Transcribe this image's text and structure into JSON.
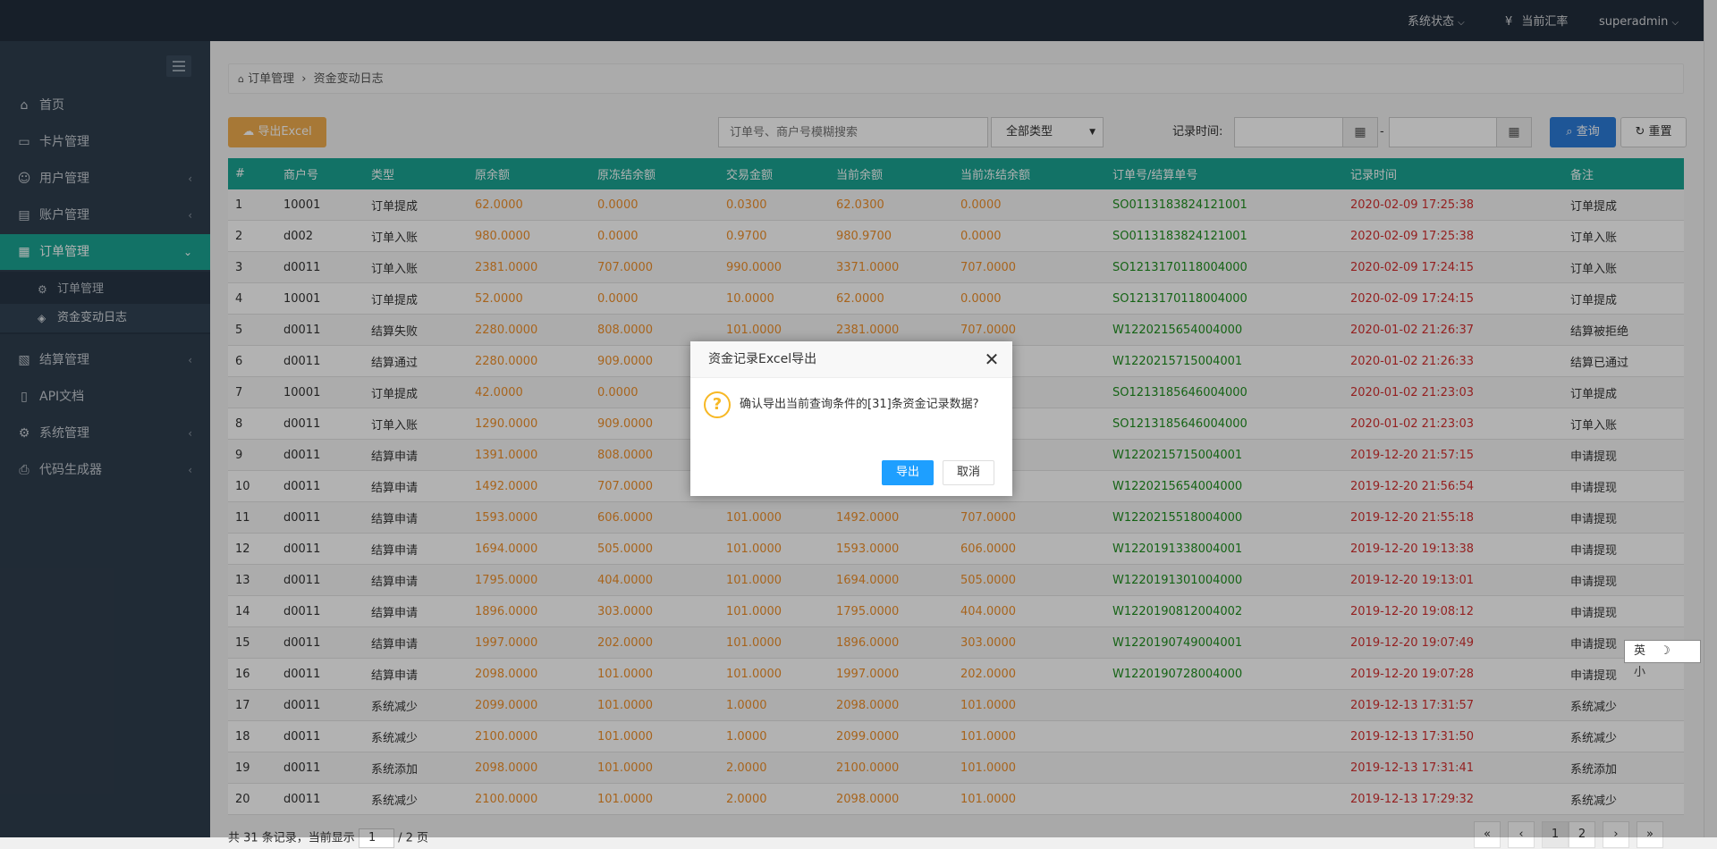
{
  "topbar": {
    "system_status": "系统状态",
    "currency_symbol": "¥",
    "exchange_rate": "当前汇率",
    "user": "superadmin"
  },
  "sidebar": {
    "items": [
      {
        "label": "首页",
        "icon": "home-icon",
        "glyph": "⌂"
      },
      {
        "label": "卡片管理",
        "icon": "card-icon",
        "glyph": "▭"
      },
      {
        "label": "用户管理",
        "icon": "user-icon",
        "glyph": "☺"
      },
      {
        "label": "账户管理",
        "icon": "account-icon",
        "glyph": "▤"
      },
      {
        "label": "订单管理",
        "icon": "order-icon",
        "glyph": "▦"
      },
      {
        "label": "结算管理",
        "icon": "settlement-icon",
        "glyph": "▧"
      },
      {
        "label": "API文档",
        "icon": "doc-icon",
        "glyph": "▯"
      },
      {
        "label": "系统管理",
        "icon": "gear-icon",
        "glyph": "⚙"
      },
      {
        "label": "代码生成器",
        "icon": "printer-icon",
        "glyph": "⎙"
      }
    ],
    "submenu": [
      {
        "label": "订单管理",
        "glyph": "⚙"
      },
      {
        "label": "资金变动日志",
        "glyph": "◈"
      }
    ]
  },
  "breadcrumb": {
    "root": "订单管理",
    "separator": "›",
    "current": "资金变动日志"
  },
  "toolbar": {
    "export_label": "导出Excel",
    "search_placeholder": "订单号、商户号模糊搜索",
    "type_select": "全部类型",
    "time_label": "记录时间:",
    "dash": "-",
    "query_label": "查询",
    "reset_label": "重置"
  },
  "table": {
    "headers": [
      "#",
      "商户号",
      "类型",
      "原余额",
      "原冻结余额",
      "交易金额",
      "当前余额",
      "当前冻结余额",
      "订单号/结算单号",
      "记录时间",
      "备注"
    ],
    "rows": [
      [
        "1",
        "10001",
        "订单提成",
        "62.0000",
        "0.0000",
        "0.0300",
        "62.0300",
        "0.0000",
        "SO0113183824121001",
        "2020-02-09 17:25:38",
        "订单提成"
      ],
      [
        "2",
        "d002",
        "订单入账",
        "980.0000",
        "0.0000",
        "0.9700",
        "980.9700",
        "0.0000",
        "SO0113183824121001",
        "2020-02-09 17:25:38",
        "订单入账"
      ],
      [
        "3",
        "d0011",
        "订单入账",
        "2381.0000",
        "707.0000",
        "990.0000",
        "3371.0000",
        "707.0000",
        "SO1213170118004000",
        "2020-02-09 17:24:15",
        "订单入账"
      ],
      [
        "4",
        "10001",
        "订单提成",
        "52.0000",
        "0.0000",
        "10.0000",
        "62.0000",
        "0.0000",
        "SO1213170118004000",
        "2020-02-09 17:24:15",
        "订单提成"
      ],
      [
        "5",
        "d0011",
        "结算失败",
        "2280.0000",
        "808.0000",
        "101.0000",
        "2381.0000",
        "707.0000",
        "W1220215654004000",
        "2020-01-02 21:26:37",
        "结算被拒绝"
      ],
      [
        "6",
        "d0011",
        "结算通过",
        "2280.0000",
        "909.0000",
        "",
        "",
        "",
        "W1220215715004001",
        "2020-01-02 21:26:33",
        "结算已通过"
      ],
      [
        "7",
        "10001",
        "订单提成",
        "42.0000",
        "0.0000",
        "",
        "",
        "",
        "SO1213185646004000",
        "2020-01-02 21:23:03",
        "订单提成"
      ],
      [
        "8",
        "d0011",
        "订单入账",
        "1290.0000",
        "909.0000",
        "",
        "",
        "",
        "SO1213185646004000",
        "2020-01-02 21:23:03",
        "订单入账"
      ],
      [
        "9",
        "d0011",
        "结算申请",
        "1391.0000",
        "808.0000",
        "",
        "",
        "",
        "W1220215715004001",
        "2019-12-20 21:57:15",
        "申请提现"
      ],
      [
        "10",
        "d0011",
        "结算申请",
        "1492.0000",
        "707.0000",
        "",
        "",
        "",
        "W1220215654004000",
        "2019-12-20 21:56:54",
        "申请提现"
      ],
      [
        "11",
        "d0011",
        "结算申请",
        "1593.0000",
        "606.0000",
        "101.0000",
        "1492.0000",
        "707.0000",
        "W1220215518004000",
        "2019-12-20 21:55:18",
        "申请提现"
      ],
      [
        "12",
        "d0011",
        "结算申请",
        "1694.0000",
        "505.0000",
        "101.0000",
        "1593.0000",
        "606.0000",
        "W1220191338004001",
        "2019-12-20 19:13:38",
        "申请提现"
      ],
      [
        "13",
        "d0011",
        "结算申请",
        "1795.0000",
        "404.0000",
        "101.0000",
        "1694.0000",
        "505.0000",
        "W1220191301004000",
        "2019-12-20 19:13:01",
        "申请提现"
      ],
      [
        "14",
        "d0011",
        "结算申请",
        "1896.0000",
        "303.0000",
        "101.0000",
        "1795.0000",
        "404.0000",
        "W1220190812004002",
        "2019-12-20 19:08:12",
        "申请提现"
      ],
      [
        "15",
        "d0011",
        "结算申请",
        "1997.0000",
        "202.0000",
        "101.0000",
        "1896.0000",
        "303.0000",
        "W1220190749004001",
        "2019-12-20 19:07:49",
        "申请提现"
      ],
      [
        "16",
        "d0011",
        "结算申请",
        "2098.0000",
        "101.0000",
        "101.0000",
        "1997.0000",
        "202.0000",
        "W1220190728004000",
        "2019-12-20 19:07:28",
        "申请提现"
      ],
      [
        "17",
        "d0011",
        "系统减少",
        "2099.0000",
        "101.0000",
        "1.0000",
        "2098.0000",
        "101.0000",
        "",
        "2019-12-13 17:31:57",
        "系统减少"
      ],
      [
        "18",
        "d0011",
        "系统减少",
        "2100.0000",
        "101.0000",
        "1.0000",
        "2099.0000",
        "101.0000",
        "",
        "2019-12-13 17:31:50",
        "系统减少"
      ],
      [
        "19",
        "d0011",
        "系统添加",
        "2098.0000",
        "101.0000",
        "2.0000",
        "2100.0000",
        "101.0000",
        "",
        "2019-12-13 17:31:41",
        "系统添加"
      ],
      [
        "20",
        "d0011",
        "系统减少",
        "2100.0000",
        "101.0000",
        "2.0000",
        "2098.0000",
        "101.0000",
        "",
        "2019-12-13 17:29:32",
        "系统减少"
      ]
    ]
  },
  "pagination": {
    "summary_prefix": "共 31 条记录，当前显示",
    "page_size": "1",
    "summary_suffix": "/ 2 页",
    "pages": [
      "«",
      "‹",
      "1",
      "2",
      "›",
      "»"
    ],
    "active_page": "1"
  },
  "dialog": {
    "title": "资金记录Excel导出",
    "close": "✕",
    "icon": "?",
    "message": "确认导出当前查询条件的[31]条资金记录数据?",
    "confirm_label": "导出",
    "cancel_label": "取消"
  },
  "ime": {
    "label": "英 ☽ 小"
  },
  "colors": {
    "topbar": "#222d3b",
    "sidebar": "#2f3e4e",
    "accent": "#1aa493",
    "export_button": "#f0ad4e",
    "query_button": "#2c7cd9",
    "dialog_confirm": "#1e9fff",
    "amount": "#f0902a",
    "order_no": "#1f8f1f",
    "time": "#d43030"
  }
}
